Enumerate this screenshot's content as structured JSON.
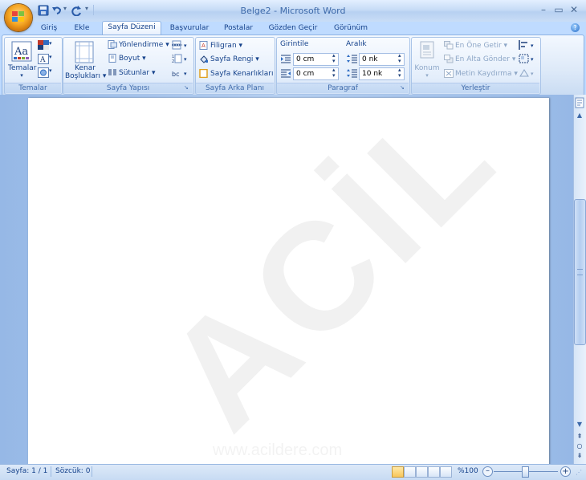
{
  "window": {
    "title": "Belge2 - Microsoft Word"
  },
  "qat": {
    "save_icon": "save-icon",
    "undo_icon": "undo-icon",
    "redo_icon": "redo-icon",
    "customize_label": "▾"
  },
  "tabs": [
    {
      "label": "Giriş"
    },
    {
      "label": "Ekle"
    },
    {
      "label": "Sayfa Düzeni"
    },
    {
      "label": "Başvurular"
    },
    {
      "label": "Postalar"
    },
    {
      "label": "Gözden Geçir"
    },
    {
      "label": "Görünüm"
    }
  ],
  "groups": {
    "temalar": {
      "label": "Temalar",
      "themes_button": "Temalar"
    },
    "sayfa_yapisi": {
      "label": "Sayfa Yapısı",
      "margins_line1": "Kenar",
      "margins_line2": "Boşlukları",
      "orientation": "Yönlendirme",
      "size": "Boyut",
      "columns": "Sütunlar"
    },
    "arka_plan": {
      "label": "Sayfa Arka Planı",
      "watermark": "Filigran",
      "page_color": "Sayfa Rengi",
      "page_borders": "Sayfa Kenarlıkları"
    },
    "paragraf": {
      "label": "Paragraf",
      "indent_header": "Girintile",
      "spacing_header": "Aralık",
      "indent_left": "0 cm",
      "indent_right": "0 cm",
      "spacing_before": "0 nk",
      "spacing_after": "10 nk"
    },
    "yerlestir": {
      "label": "Yerleştir",
      "position": "Konum",
      "bring_front": "En Öne Getir",
      "send_back": "En Alta Gönder",
      "text_wrap": "Metin Kaydırma"
    }
  },
  "document": {
    "watermark_text": "ACİL",
    "watermark_url": "www.acildere.com"
  },
  "status": {
    "page": "Sayfa: 1 / 1",
    "words": "Sözcük: 0",
    "zoom": "%100"
  },
  "colors": {
    "accent": "#15428b",
    "ribbon_bg": "#dde9f8",
    "doc_bg": "#a8c6ef"
  }
}
